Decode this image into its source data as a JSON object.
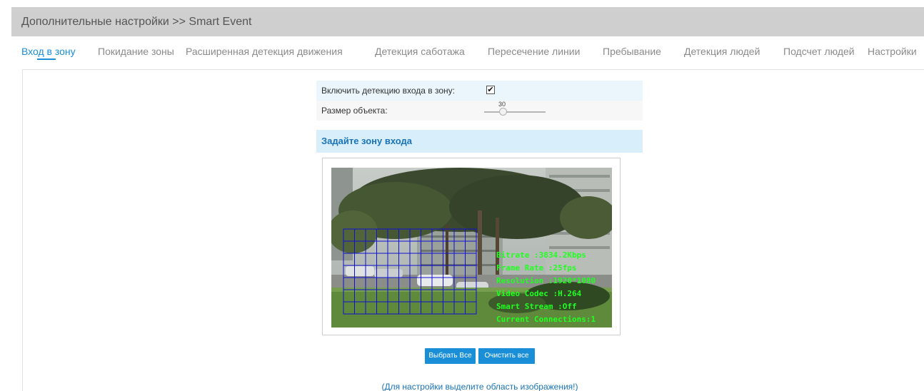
{
  "header": {
    "title": "Дополнительные настройки >> Smart Event"
  },
  "tabs": [
    {
      "label": "Вход в зону",
      "active": true
    },
    {
      "label": "Покидание зоны",
      "active": false
    },
    {
      "label": "Расширенная детекция движения",
      "active": false
    },
    {
      "label": "Детекция саботажа",
      "active": false
    },
    {
      "label": "Пересечение линии",
      "active": false
    },
    {
      "label": "Пребывание",
      "active": false
    },
    {
      "label": "Детекция людей",
      "active": false
    },
    {
      "label": "Подсчет людей",
      "active": false
    },
    {
      "label": "Настройки",
      "active": false
    }
  ],
  "settings": {
    "enable_label": "Включить детекцию входа в зону:",
    "enable_checked": true,
    "object_size_label": "Размер объекта:",
    "object_size_value": "30"
  },
  "zone": {
    "title": "Задайте зону входа",
    "grid_cols": 12,
    "grid_rows": 7
  },
  "overlay": {
    "lines": [
      "Bitrate :3834.2Kbps",
      "Frame Rate :25fps",
      "Resolution :1920*1080",
      "Video Codec :H.264",
      "Smart Stream :Off",
      "Current Connections:1"
    ]
  },
  "buttons": {
    "select_all": "Выбрать Все",
    "clear_all": "Очистить все"
  },
  "hint": "(Для настройки выделите область изображения!)",
  "colors": {
    "accent": "#1a8ed6",
    "overlay_text": "#22ff22",
    "grid": "#1010d0"
  }
}
